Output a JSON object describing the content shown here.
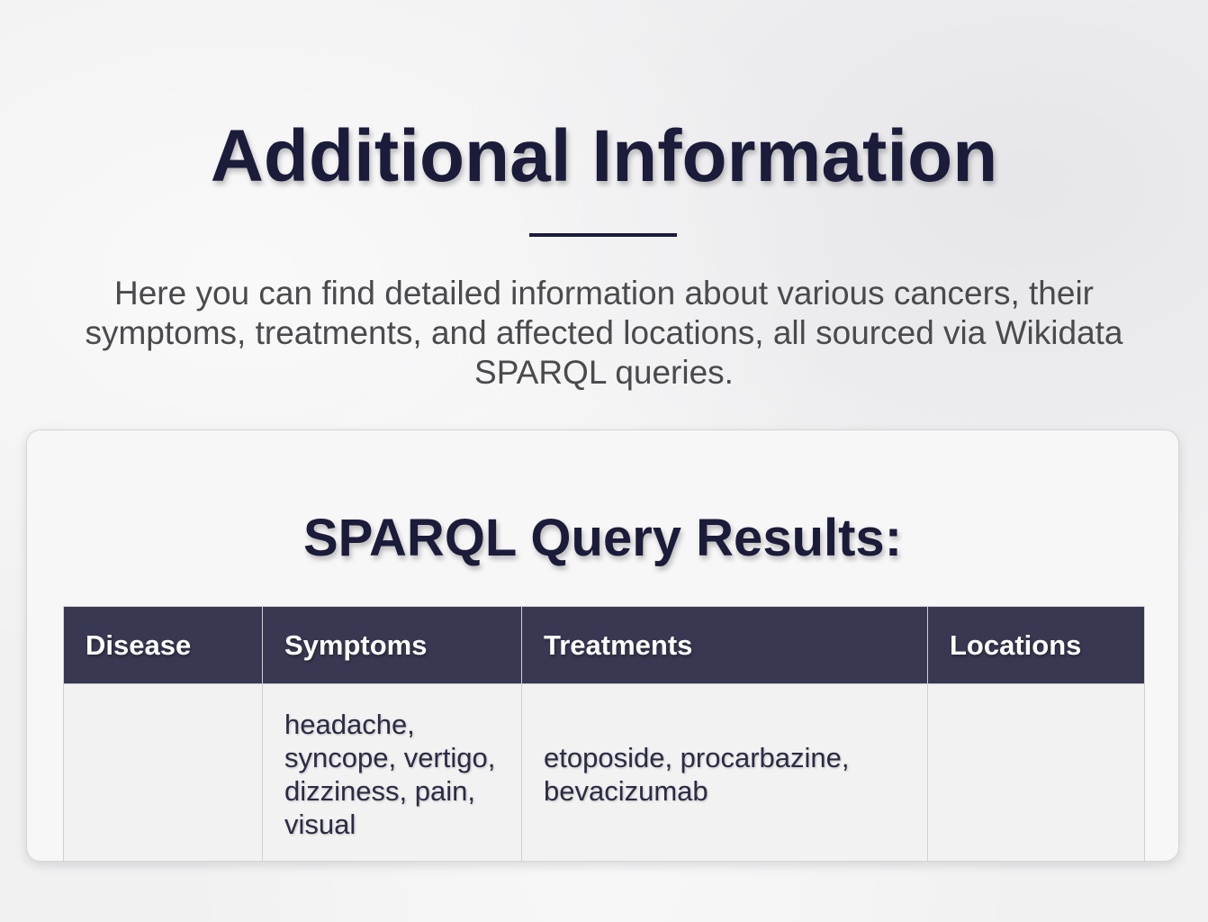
{
  "header": {
    "title": "Additional Information",
    "intro": "Here you can find detailed information about various cancers, their symptoms, treatments, and affected locations, all sourced via Wikidata SPARQL queries."
  },
  "results": {
    "title": "SPARQL Query Results:",
    "columns": [
      "Disease",
      "Symptoms",
      "Treatments",
      "Locations"
    ],
    "rows": [
      {
        "disease": "",
        "symptoms": "headache, syncope, vertigo, dizziness, pain, visual",
        "treatments": "etoposide, procarbazine, bevacizumab",
        "locations": ""
      }
    ]
  },
  "colors": {
    "heading": "#1b1b3a",
    "table_header_bg": "#383852",
    "background": "#f1f1f2"
  }
}
